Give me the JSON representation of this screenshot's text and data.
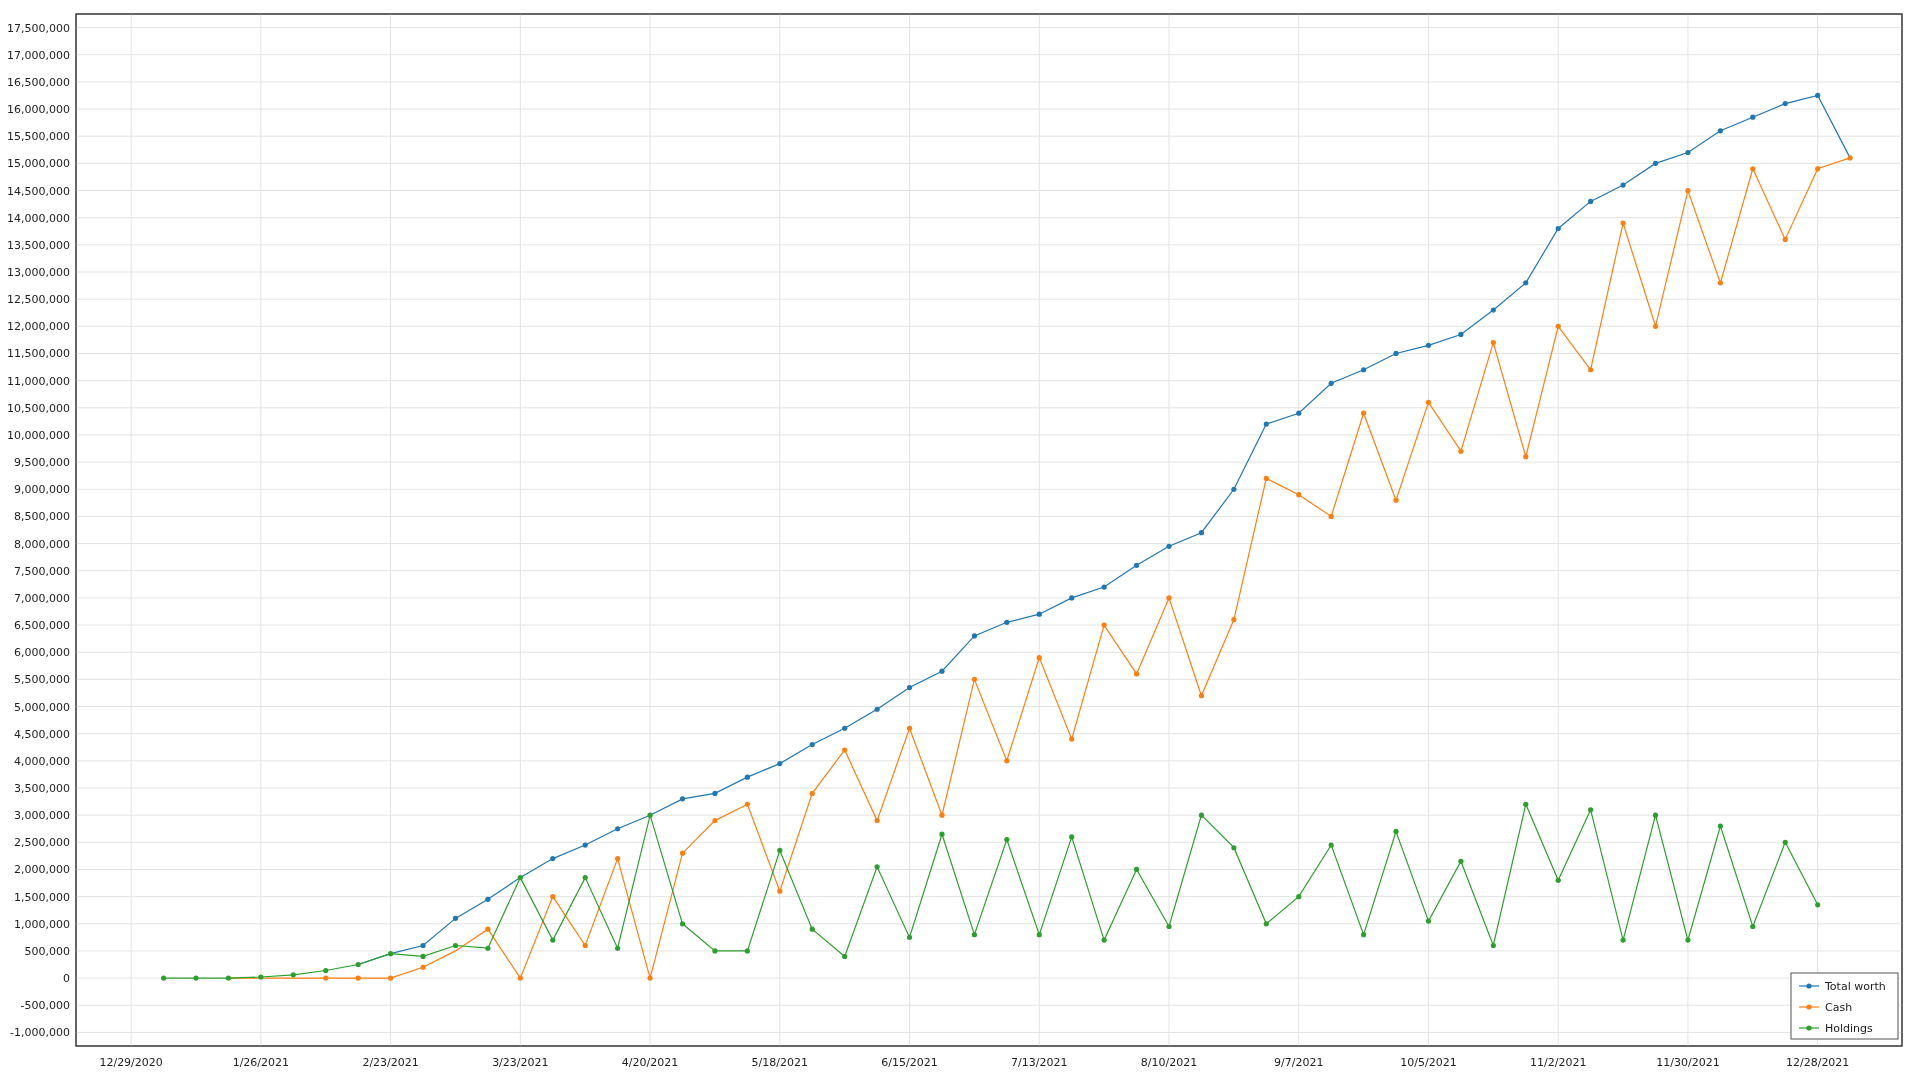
{
  "chart": {
    "chart_data": {
      "type": "line",
      "categories": [
        "12/29/2020",
        null,
        null,
        null,
        "1/26/2021",
        null,
        null,
        null,
        "2/23/2021",
        null,
        null,
        null,
        "3/23/2021",
        null,
        null,
        null,
        "4/20/2021",
        null,
        null,
        null,
        "5/18/2021",
        null,
        null,
        null,
        "6/15/2021",
        null,
        null,
        null,
        "7/13/2021",
        null,
        null,
        null,
        "8/10/2021",
        null,
        null,
        null,
        "9/7/2021",
        null,
        null,
        null,
        "10/5/2021",
        null,
        null,
        null,
        "11/2/2021",
        null,
        null,
        null,
        "11/30/2021",
        null,
        null,
        null,
        "12/28/2021",
        null
      ],
      "series": [
        {
          "name": "Total worth",
          "color": "#1f77b4",
          "values": [
            null,
            null,
            null,
            null,
            null,
            null,
            null,
            250000,
            450000,
            600000,
            1100000,
            1450000,
            1850000,
            2200000,
            2450000,
            2750000,
            3000000,
            3300000,
            3400000,
            3700000,
            3950000,
            4300000,
            4600000,
            4950000,
            5350000,
            5650000,
            6300000,
            6550000,
            6700000,
            7000000,
            7200000,
            7600000,
            7950000,
            8200000,
            9000000,
            10200000,
            10400000,
            10950000,
            11200000,
            11500000,
            11650000,
            11850000,
            12300000,
            12800000,
            13800000,
            14300000,
            14600000,
            15000000,
            15200000,
            15600000,
            15850000,
            16100000,
            16250000,
            15100000
          ]
        },
        {
          "name": "Cash",
          "color": "#ff7f0e",
          "values": [
            null,
            null,
            null,
            0,
            0,
            0,
            0,
            0,
            0,
            200000,
            500000,
            900000,
            0,
            1500000,
            600000,
            2200000,
            0,
            2300000,
            2900000,
            3200000,
            1600000,
            3400000,
            4200000,
            2900000,
            4600000,
            3000000,
            5500000,
            4000000,
            5900000,
            4400000,
            6500000,
            5600000,
            7000000,
            5200000,
            6600000,
            9200000,
            8900000,
            8500000,
            10400000,
            8800000,
            10600000,
            9700000,
            11700000,
            9600000,
            12000000,
            11200000,
            13900000,
            12000000,
            14500000,
            12800000,
            14900000,
            13600000,
            14900000,
            15100000
          ]
        },
        {
          "name": "Holdings",
          "color": "#2ca02c",
          "values": [
            null,
            0,
            0,
            0,
            20000,
            60000,
            140000,
            250000,
            450000,
            400000,
            600000,
            550000,
            1850000,
            700000,
            1850000,
            550000,
            3000000,
            1000000,
            500000,
            500000,
            2350000,
            900000,
            400000,
            2050000,
            750000,
            2650000,
            800000,
            2550000,
            800000,
            2600000,
            700000,
            2000000,
            950000,
            3000000,
            2400000,
            1000000,
            1500000,
            2450000,
            800000,
            2700000,
            1050000,
            2150000,
            600000,
            3200000,
            1800000,
            3100000,
            700000,
            3000000,
            700000,
            2800000,
            950000,
            2500000,
            1350000,
            null
          ]
        }
      ],
      "grid": true,
      "legend": true,
      "ylim": [
        -1250000,
        17750000
      ],
      "yticks": [
        {
          "value": -1000000,
          "label": "-1,000,000"
        },
        {
          "value": -500000,
          "label": "-500,000"
        },
        {
          "value": 0,
          "label": "0"
        },
        {
          "value": 500000,
          "label": "500,000"
        },
        {
          "value": 1000000,
          "label": "1,000,000"
        },
        {
          "value": 1500000,
          "label": "1,500,000"
        },
        {
          "value": 2000000,
          "label": "2,000,000"
        },
        {
          "value": 2500000,
          "label": "2,500,000"
        },
        {
          "value": 3000000,
          "label": "3,000,000"
        },
        {
          "value": 3500000,
          "label": "3,500,000"
        },
        {
          "value": 4000000,
          "label": "4,000,000"
        },
        {
          "value": 4500000,
          "label": "4,500,000"
        },
        {
          "value": 5000000,
          "label": "5,000,000"
        },
        {
          "value": 5500000,
          "label": "5,500,000"
        },
        {
          "value": 6000000,
          "label": "6,000,000"
        },
        {
          "value": 6500000,
          "label": "6,500,000"
        },
        {
          "value": 7000000,
          "label": "7,000,000"
        },
        {
          "value": 7500000,
          "label": "7,500,000"
        },
        {
          "value": 8000000,
          "label": "8,000,000"
        },
        {
          "value": 8500000,
          "label": "8,500,000"
        },
        {
          "value": 9000000,
          "label": "9,000,000"
        },
        {
          "value": 9500000,
          "label": "9,500,000"
        },
        {
          "value": 10000000,
          "label": "10,000,000"
        },
        {
          "value": 10500000,
          "label": "10,500,000"
        },
        {
          "value": 11000000,
          "label": "11,000,000"
        },
        {
          "value": 11500000,
          "label": "11,500,000"
        },
        {
          "value": 12000000,
          "label": "12,000,000"
        },
        {
          "value": 12500000,
          "label": "12,500,000"
        },
        {
          "value": 13000000,
          "label": "13,000,000"
        },
        {
          "value": 13500000,
          "label": "13,500,000"
        },
        {
          "value": 14000000,
          "label": "14,000,000"
        },
        {
          "value": 14500000,
          "label": "14,500,000"
        },
        {
          "value": 15000000,
          "label": "15,000,000"
        },
        {
          "value": 15500000,
          "label": "15,500,000"
        },
        {
          "value": 16000000,
          "label": "16,000,000"
        },
        {
          "value": 16500000,
          "label": "16,500,000"
        },
        {
          "value": 17000000,
          "label": "17,000,000"
        },
        {
          "value": 17500000,
          "label": "17,500,000"
        }
      ]
    }
  }
}
